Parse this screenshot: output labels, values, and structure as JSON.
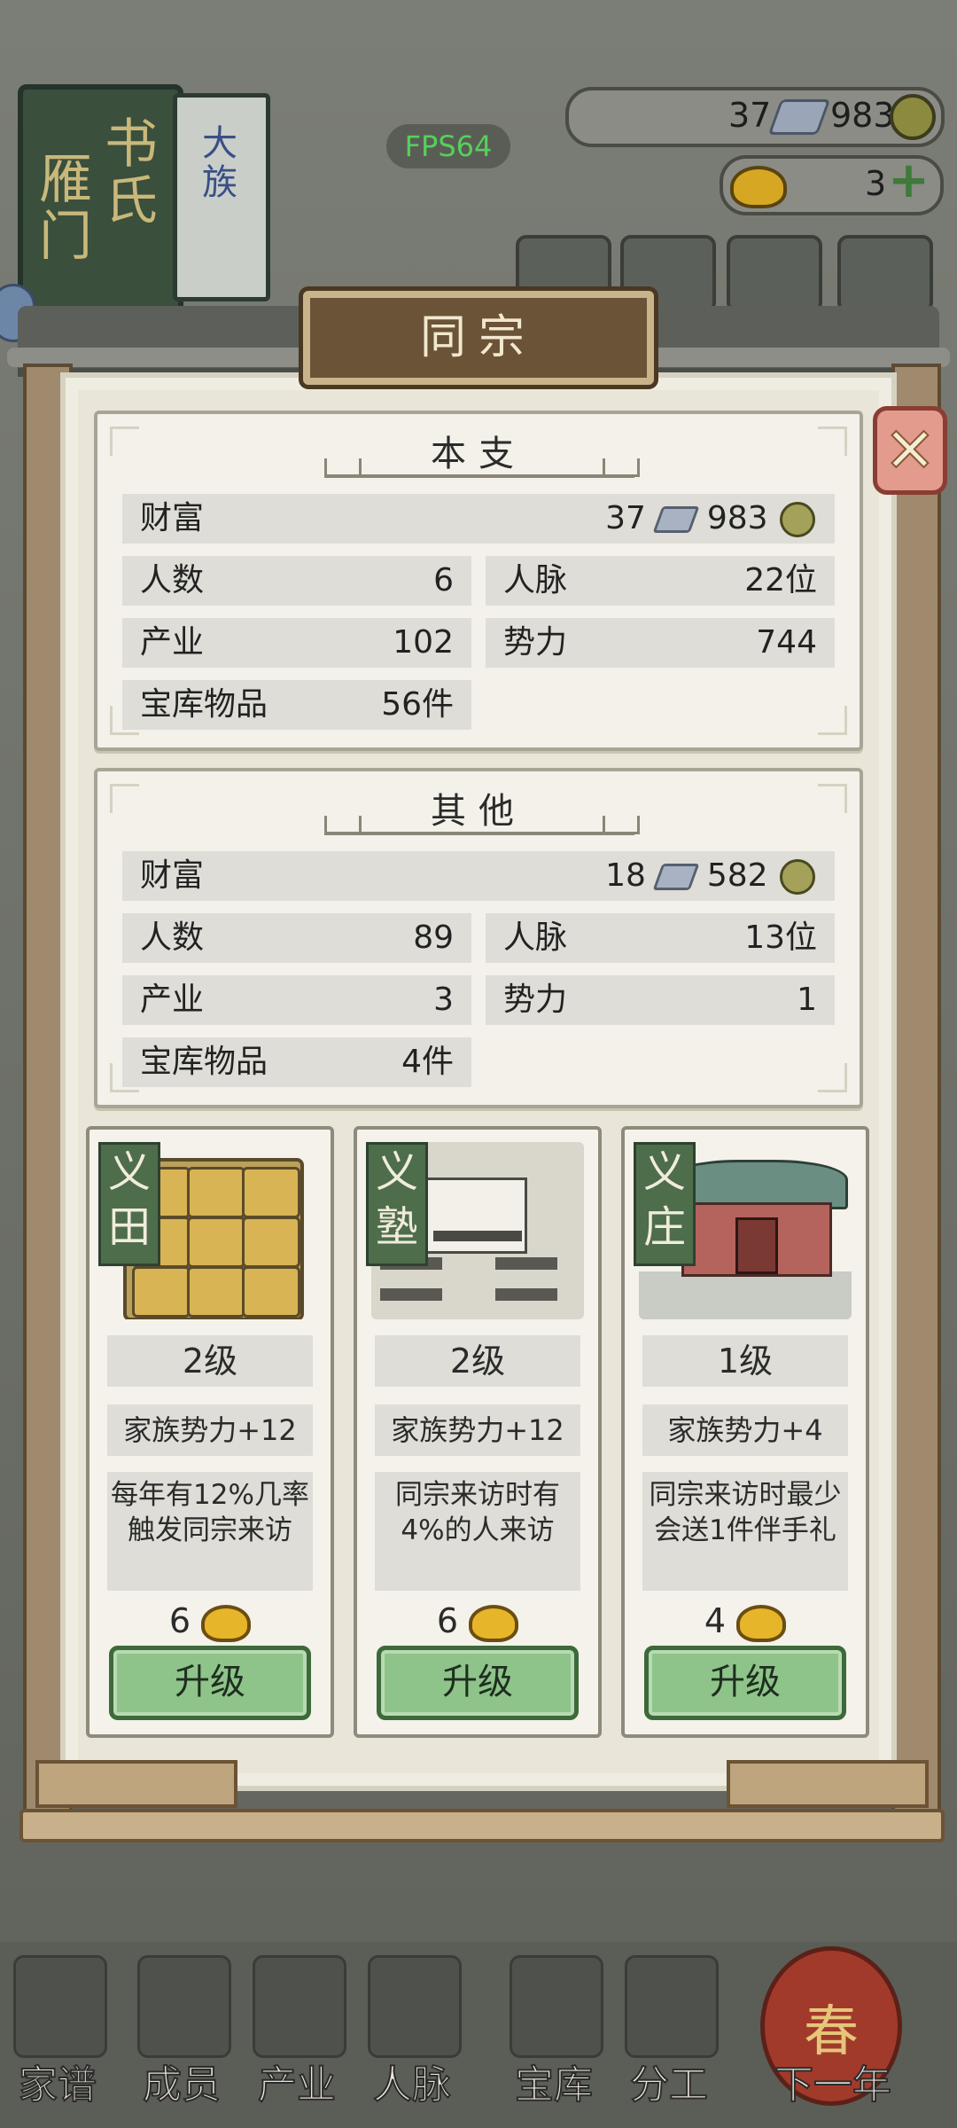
{
  "background": {
    "book_title": "雁门书氏",
    "book_title_cols": [
      "雁门",
      "书氏"
    ],
    "book_tag": "大族",
    "silver": "37",
    "copper": "983",
    "gold": "3",
    "fps": "FPS64"
  },
  "bottom_nav": [
    {
      "label": "家谱"
    },
    {
      "label": "成员"
    },
    {
      "label": "产业"
    },
    {
      "label": "人脉"
    },
    {
      "label": "宝库"
    },
    {
      "label": "分工"
    },
    {
      "label": "下一年"
    }
  ],
  "lantern": "春",
  "modal": {
    "title": "同宗",
    "main_branch": {
      "title": "本支",
      "wealth_label": "财富",
      "wealth_silver": "37",
      "wealth_copper": "983",
      "people_label": "人数",
      "people": "6",
      "network_label": "人脉",
      "network": "22位",
      "industry_label": "产业",
      "industry": "102",
      "power_label": "势力",
      "power": "744",
      "vault_label": "宝库物品",
      "vault": "56件"
    },
    "others": {
      "title": "其他",
      "wealth_label": "财富",
      "wealth_silver": "18",
      "wealth_copper": "582",
      "people_label": "人数",
      "people": "89",
      "network_label": "人脉",
      "network": "13位",
      "industry_label": "产业",
      "industry": "3",
      "power_label": "势力",
      "power": "1",
      "vault_label": "宝库物品",
      "vault": "4件"
    },
    "buildings": [
      {
        "name": "义田",
        "name_cols": [
          "义",
          "田"
        ],
        "level": "2级",
        "effect": "家族势力+12",
        "desc": "每年有12%几率触发同宗来访",
        "cost": "6",
        "button": "升级"
      },
      {
        "name": "义塾",
        "name_cols": [
          "义",
          "塾"
        ],
        "level": "2级",
        "effect": "家族势力+12",
        "desc": "同宗来访时有4%的人来访",
        "cost": "6",
        "button": "升级"
      },
      {
        "name": "义庄",
        "name_cols": [
          "义",
          "庄"
        ],
        "level": "1级",
        "effect": "家族势力+4",
        "desc": "同宗来访时最少会送1件伴手礼",
        "cost": "4",
        "button": "升级"
      }
    ],
    "close_glyph": "✕"
  },
  "colors": {
    "panel_bg": "#f3f1ea",
    "row_bg": "#deddd7",
    "upgrade_button": "#8ec48a",
    "tag_green": "#4e6d4b",
    "plaque_brown": "#6b5337"
  }
}
